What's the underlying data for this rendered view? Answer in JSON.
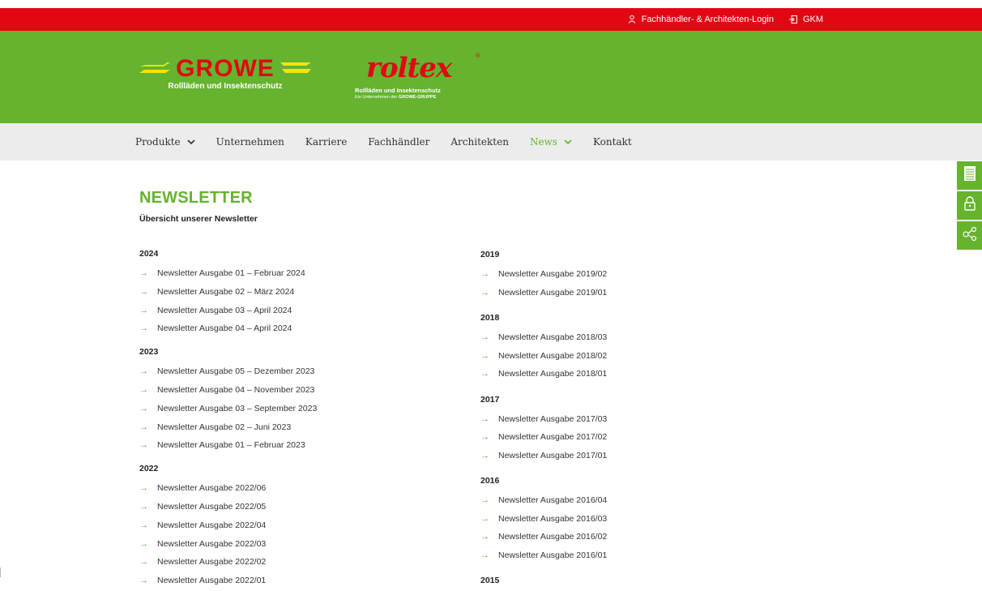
{
  "topbar": {
    "login_label": "Fachhändler- & Architekten-Login",
    "gkm_label": "GKM",
    "login_icon": "user-network-icon",
    "gkm_icon": "login-arrow-icon",
    "color": "#e30613"
  },
  "header": {
    "color": "#65b32e",
    "growe_logo_text": "GROWE",
    "growe_subtitle": "Rollläden und Insektenschutz",
    "roltex_logo_text": "roltex",
    "roltex_reg": "®",
    "roltex_subtitle": "Rollläden und Insektenschutz",
    "roltex_tagline_prefix": "Ein Unternehmen der",
    "roltex_tagline_brand": "GROWE-GRUPPE"
  },
  "nav": {
    "items": [
      {
        "label": "Produkte",
        "has_dropdown": true,
        "active": false
      },
      {
        "label": "Unternehmen",
        "has_dropdown": false,
        "active": false
      },
      {
        "label": "Karriere",
        "has_dropdown": false,
        "active": false
      },
      {
        "label": "Fachhändler",
        "has_dropdown": false,
        "active": false
      },
      {
        "label": "Architekten",
        "has_dropdown": false,
        "active": false
      },
      {
        "label": "News",
        "has_dropdown": true,
        "active": true
      },
      {
        "label": "Kontakt",
        "has_dropdown": false,
        "active": false
      }
    ]
  },
  "side_tools": [
    "document-icon",
    "lock-icon",
    "network-icon"
  ],
  "page": {
    "title": "NEWSLETTER",
    "subtitle": "Übersicht unserer Newsletter"
  },
  "newsletters": {
    "left": [
      {
        "year": "2024",
        "items": [
          "Newsletter Ausgabe 01 – Februar 2024",
          "Newsletter Ausgabe 02 – März 2024",
          "Newsletter Ausgabe 03 – April 2024",
          "Newsletter Ausgabe 04 – April 2024"
        ]
      },
      {
        "year": "2023",
        "items": [
          "Newsletter Ausgabe 05 – Dezember 2023",
          "Newsletter Ausgabe 04 – November 2023",
          "Newsletter Ausgabe 03 – September 2023",
          "Newsletter Ausgabe 02 – Juni 2023",
          "Newsletter Ausgabe 01 – Februar 2023"
        ]
      },
      {
        "year": "2022",
        "items": [
          "Newsletter Ausgabe 2022/06",
          "Newsletter Ausgabe 2022/05",
          "Newsletter Ausgabe 2022/04",
          "Newsletter Ausgabe 2022/03",
          "Newsletter Ausgabe 2022/02",
          "Newsletter Ausgabe 2022/01"
        ]
      }
    ],
    "right": [
      {
        "year": "2019",
        "items": [
          "Newsletter Ausgabe 2019/02",
          "Newsletter Ausgabe 2019/01"
        ]
      },
      {
        "year": "2018",
        "items": [
          "Newsletter Ausgabe 2018/03",
          "Newsletter Ausgabe 2018/02",
          "Newsletter Ausgabe 2018/01"
        ]
      },
      {
        "year": "2017",
        "items": [
          "Newsletter Ausgabe 2017/03",
          "Newsletter Ausgabe 2017/02",
          "Newsletter Ausgabe 2017/01"
        ]
      },
      {
        "year": "2016",
        "items": [
          "Newsletter Ausgabe 2016/04",
          "Newsletter Ausgabe 2016/03",
          "Newsletter Ausgabe 2016/02",
          "Newsletter Ausgabe 2016/01"
        ]
      },
      {
        "year": "2015",
        "items": []
      }
    ]
  },
  "link_arrow": "→"
}
